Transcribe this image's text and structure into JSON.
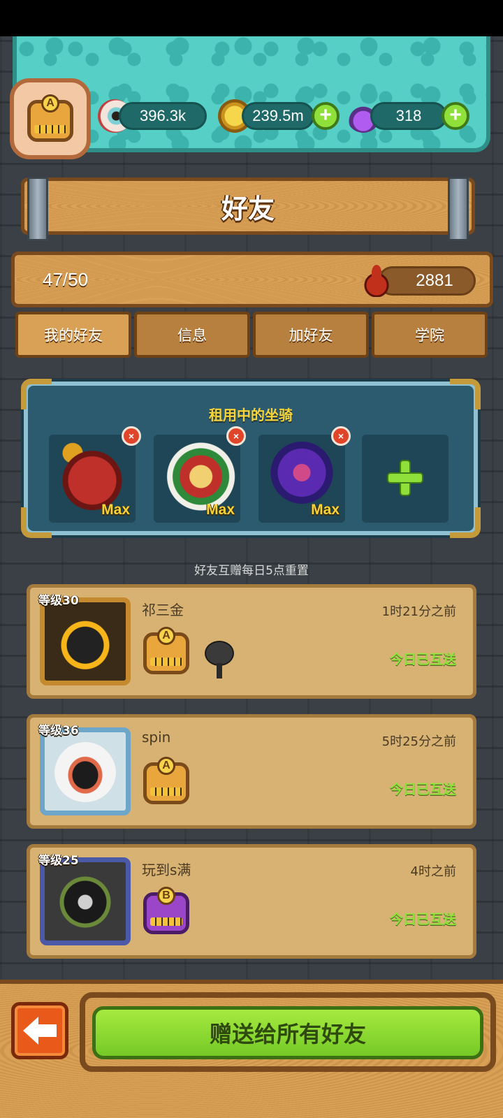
{
  "header": {
    "player_rank": "A",
    "eyes": "396.3k",
    "coins": "239.5m",
    "potions": "318",
    "plus": "+"
  },
  "title": "好友",
  "friends_count": "47/50",
  "blood": "2881",
  "tabs": [
    {
      "label": "我的好友",
      "active": true
    },
    {
      "label": "信息",
      "active": false
    },
    {
      "label": "加好友",
      "active": false
    },
    {
      "label": "学院",
      "active": false
    }
  ],
  "mounts": {
    "title": "租用中的坐骑",
    "slots": [
      {
        "label": "Max",
        "remove": "×"
      },
      {
        "label": "Max",
        "remove": "×"
      },
      {
        "label": "Max",
        "remove": "×"
      }
    ]
  },
  "gift_note": "好友互赠每日5点重置",
  "friends": [
    {
      "level": "等级30",
      "name": "祁三金",
      "last_seen": "1时21分之前",
      "status": "今日已互送",
      "rank": "A"
    },
    {
      "level": "等级36",
      "name": "spin",
      "last_seen": "5时25分之前",
      "status": "今日已互送",
      "rank": "A"
    },
    {
      "level": "等级25",
      "name": "玩到s满",
      "last_seen": "4时之前",
      "status": "今日已互送",
      "rank": "B"
    }
  ],
  "send_all": "赠送给所有好友",
  "colors": {
    "accent_green": "#8fe03a",
    "gold_text": "#f7d33a",
    "wood": "#d9a156",
    "teal": "#56cfc6"
  }
}
